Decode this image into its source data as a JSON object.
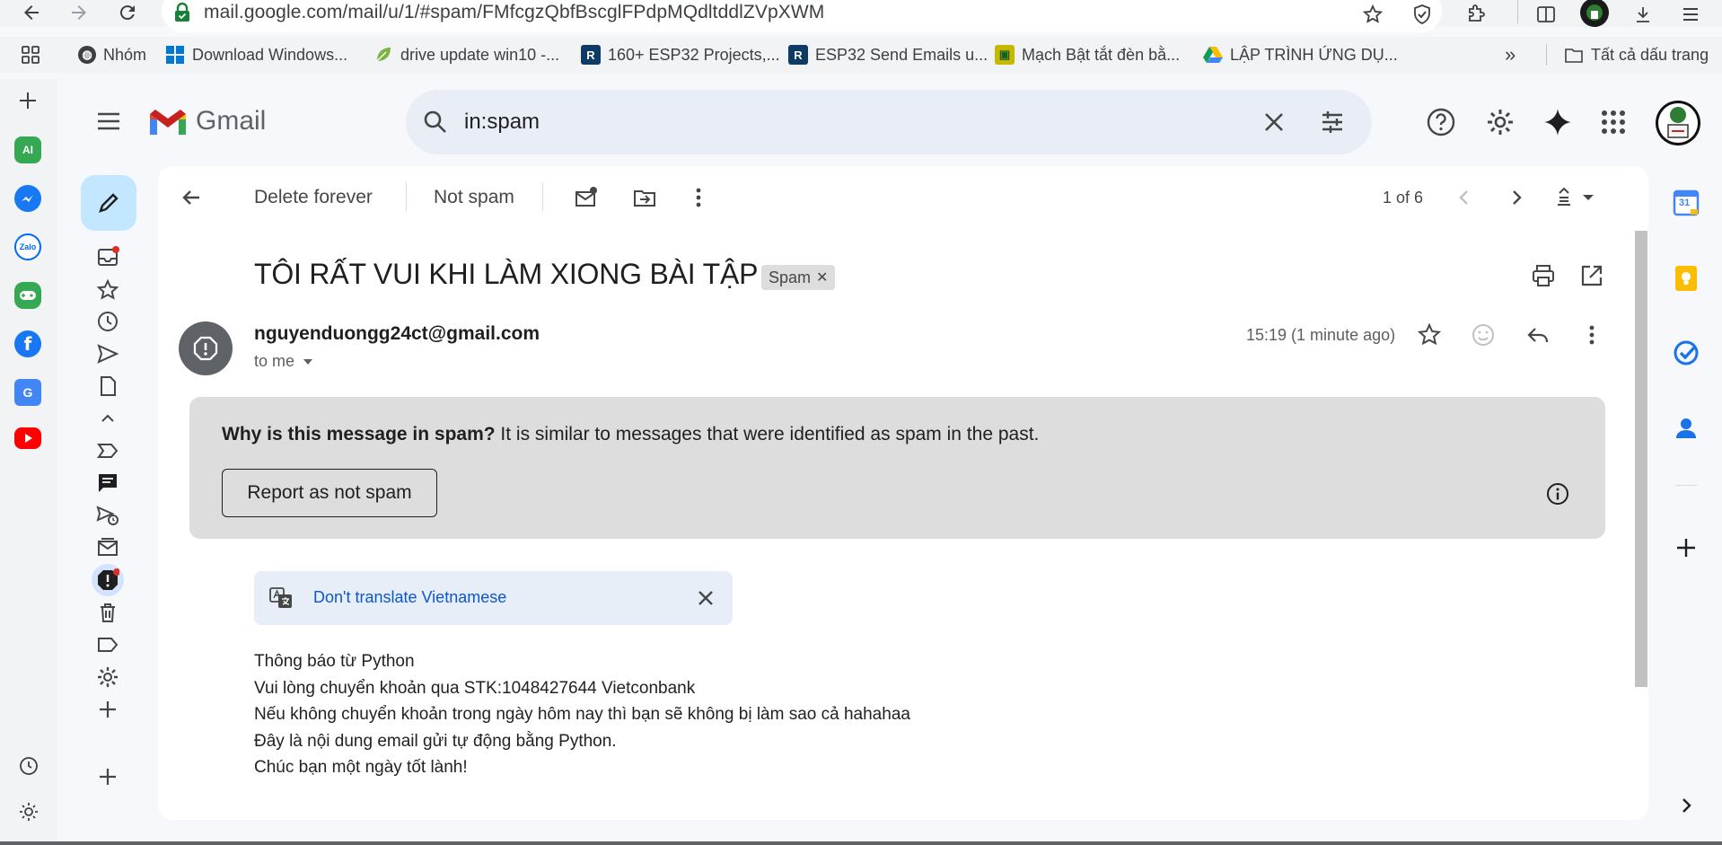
{
  "browser": {
    "url": "mail.google.com/mail/u/1/#spam/FMfcgzQbfBscglFPdpMQdltddlZVpXWM",
    "icons": [
      "back-icon",
      "forward-icon",
      "reload-icon",
      "secure-icon",
      "star-icon",
      "shield-icon",
      "extensions-icon",
      "split-view-icon",
      "profile-avatar",
      "download-icon",
      "menu-icon"
    ]
  },
  "bookmarks": {
    "items": [
      {
        "label": "Nhóm"
      },
      {
        "label": "Download Windows..."
      },
      {
        "label": "drive update win10 -..."
      },
      {
        "label": "160+ ESP32 Projects,..."
      },
      {
        "label": "ESP32 Send Emails u..."
      },
      {
        "label": "Mạch Bật tắt đèn bằ..."
      },
      {
        "label": "LẬP TRÌNH ỨNG DỤ..."
      }
    ],
    "overflow": "»",
    "all_bookmarks": "Tất cả dấu trang"
  },
  "edge_sidebar": {
    "ai_label": "AI",
    "zalo_label": "Zalo"
  },
  "gmail": {
    "logo_text": "Gmail",
    "search_value": "in:spam"
  },
  "toolbar": {
    "delete_forever": "Delete forever",
    "not_spam": "Not spam",
    "pagination": "1 of 6"
  },
  "email": {
    "subject": "TÔI RẤT VUI KHI LÀM XIONG BÀI TẬP",
    "label_chip": "Spam",
    "sender": "nguyenduongg24ct@gmail.com",
    "recipient": "to me",
    "timestamp": "15:19 (1 minute ago)",
    "spam_why_bold": "Why is this message in spam?",
    "spam_why_text": " It is similar to messages that were identified as spam in the past.",
    "report_button": "Report as not spam",
    "translate_text": "Don't translate Vietnamese",
    "body_lines": [
      "Thông báo từ Python",
      "Vui lòng chuyển khoản qua STK:1048427644 Vietconbank",
      "Nếu không chuyển khoản trong ngày hôm nay thì bạn sẽ không bị làm sao cả hahahaa",
      "Đây là nội dung email gửi tự động bằng Python.",
      "Chúc bạn một ngày tốt lành!"
    ]
  },
  "side_panel": {
    "calendar_day": "31"
  },
  "colors": {
    "accent_blue": "#0b57d0",
    "compose_bg": "#c2e7ff",
    "spam_banner": "#dddddd",
    "unread_dot": "#d93025"
  }
}
